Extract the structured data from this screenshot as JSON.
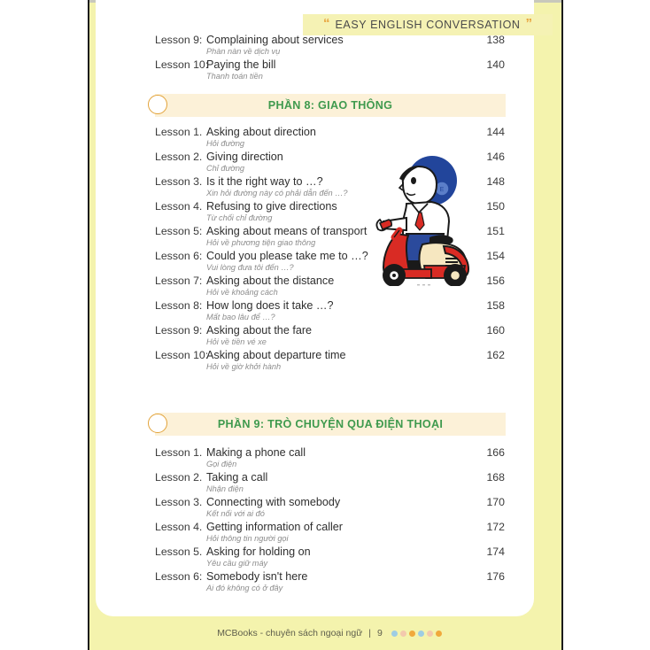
{
  "header": {
    "title": "EASY ENGLISH CONVERSATION",
    "quote_open": "“",
    "quote_close": "”"
  },
  "continued_lessons": [
    {
      "label": "Lesson 9:",
      "title": "Complaining about services",
      "sub": "Phàn nàn về dịch vụ",
      "page": "138"
    },
    {
      "label": "Lesson 10:",
      "title": "Paying the bill",
      "sub": "Thanh toán tiền",
      "page": "140"
    }
  ],
  "sections": [
    {
      "bar_title": "PHẦN 8: GIAO THÔNG",
      "lessons": [
        {
          "label": "Lesson 1.",
          "title": "Asking about direction",
          "sub": "Hỏi đường",
          "page": "144"
        },
        {
          "label": "Lesson 2.",
          "title": "Giving direction",
          "sub": "Chỉ đường",
          "page": "146"
        },
        {
          "label": "Lesson 3.",
          "title": "Is it the right way to …?",
          "sub": "Xin hỏi đường này có phải dẫn đến …?",
          "page": "148"
        },
        {
          "label": "Lesson 4.",
          "title": "Refusing to give directions",
          "sub": "Từ chối chỉ đường",
          "page": "150"
        },
        {
          "label": "Lesson 5:",
          "title": "Asking about means of transport",
          "sub": "Hỏi về phương tiện giao thông",
          "page": "151"
        },
        {
          "label": "Lesson 6:",
          "title": "Could you please take me to …?",
          "sub": "Vui  lòng đưa tôi đến …?",
          "page": "154"
        },
        {
          "label": "Lesson 7:",
          "title": "Asking about the distance",
          "sub": "Hỏi về khoảng cách",
          "page": "156"
        },
        {
          "label": "Lesson 8:",
          "title": "How long does it take …?",
          "sub": "Mất bao lâu để …?",
          "page": "158"
        },
        {
          "label": "Lesson 9:",
          "title": "Asking about the fare",
          "sub": "Hỏi về tiền vé xe",
          "page": "160"
        },
        {
          "label": "Lesson 10:",
          "title": "Asking about departure time",
          "sub": "Hỏi về giờ khởi hành",
          "page": "162"
        }
      ]
    },
    {
      "bar_title": "PHẦN 9: TRÒ CHUYỆN QUA ĐIỆN THOẠI",
      "lessons": [
        {
          "label": "Lesson 1.",
          "title": "Making a phone call",
          "sub": "Gọi điện",
          "page": "166"
        },
        {
          "label": "Lesson 2.",
          "title": "Taking a call",
          "sub": "Nhận điện",
          "page": "168"
        },
        {
          "label": "Lesson 3.",
          "title": "Connecting with somebody",
          "sub": "Kết nối với ai đó",
          "page": "170"
        },
        {
          "label": "Lesson 4.",
          "title": "Getting information of caller",
          "sub": "Hỏi thông tin người gọi",
          "page": "172"
        },
        {
          "label": "Lesson 5.",
          "title": "Asking for holding on",
          "sub": "Yêu cầu giữ máy",
          "page": "174"
        },
        {
          "label": "Lesson 6:",
          "title": "Somebody isn't here",
          "sub": "Ai đó không có ở đây",
          "page": "176"
        }
      ]
    }
  ],
  "illustration": {
    "name": "boy-riding-scooter",
    "colors": {
      "helmet": "#22459b",
      "helmet_badge": "#5b7ec9",
      "scooter_body_red": "#d92b24",
      "scooter_body_cream": "#f6e7c0",
      "pants_blue": "#2b4a9c",
      "shirt_white": "#ffffff",
      "tie_red": "#d92b24",
      "wheel_black": "#1a1a1a",
      "skin": "#ffffff",
      "outline": "#1a1a1a"
    }
  },
  "footer": {
    "text": "MCBooks - chuyên sách ngoại ngữ",
    "separator": "|",
    "page_number": "9",
    "dots": [
      "#9ecde3",
      "#f3c9ad",
      "#f0a93c",
      "#9ecde3",
      "#f3c9ad",
      "#f0a93c"
    ]
  },
  "theme": {
    "page_yellow": "#f4f3ad",
    "banner_yellow": "#f5f2b4",
    "section_bar_cream": "#fcf1d8",
    "section_title_green": "#3f9a4e",
    "circle_orange": "#e2a33a",
    "spine_dark": "#1b1b1b"
  }
}
